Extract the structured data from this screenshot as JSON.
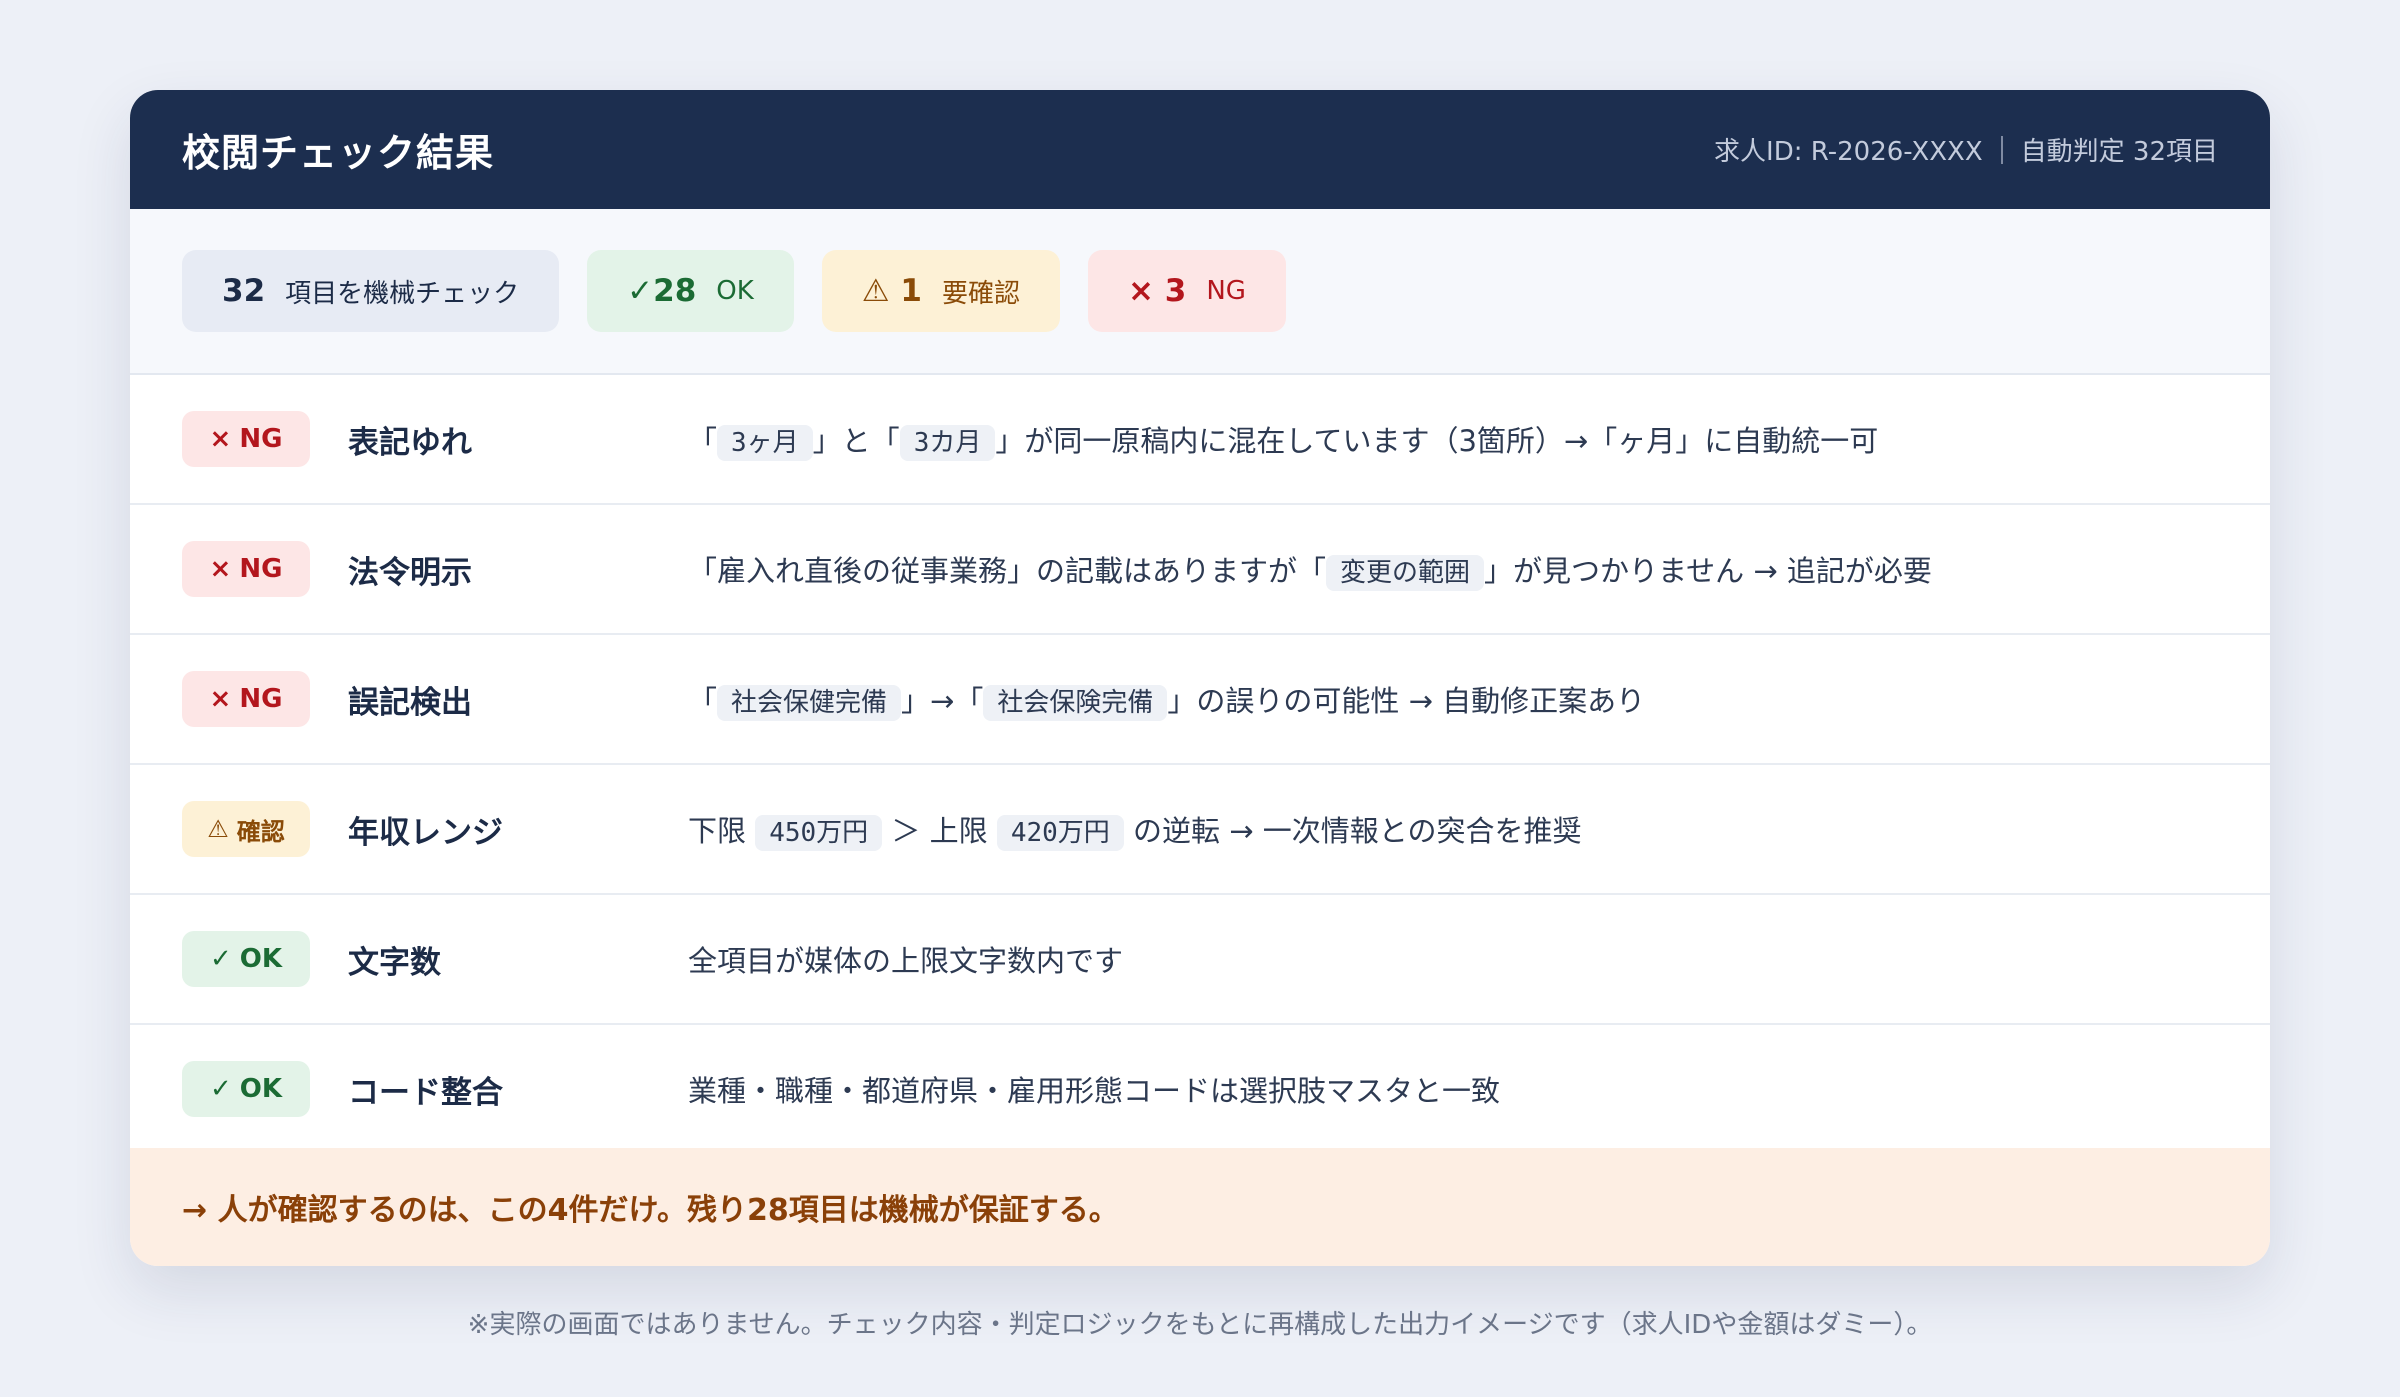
{
  "header": {
    "title": "校閲チェック結果",
    "job_id": "求人ID: R-2026-XXXX",
    "auto_judge": "自動判定 32項目"
  },
  "summary": {
    "total": {
      "num": "32",
      "label": "項目を機械チェック"
    },
    "ok": {
      "symbol": "✓",
      "num": "28",
      "label": "OK"
    },
    "warn": {
      "symbol": "⚠",
      "num": "1",
      "label": "要確認"
    },
    "ng": {
      "symbol": "×",
      "num": "3",
      "label": "NG"
    }
  },
  "rows": [
    {
      "status": "ng",
      "badge_symbol": "×",
      "badge_text": "NG",
      "label": "表記ゆれ",
      "msg": {
        "p1": "「",
        "c1": "3ヶ月",
        "p2": "」と「",
        "c2": "3カ月",
        "p3": "」が同一原稿内に混在しています（3箇所）→「ヶ月」に自動統一可"
      }
    },
    {
      "status": "ng",
      "badge_symbol": "×",
      "badge_text": "NG",
      "label": "法令明示",
      "msg": {
        "p1": "「雇入れ直後の従事業務」の記載はありますが「",
        "c1": "変更の範囲",
        "p2": "」が見つかりません → 追記が必要"
      }
    },
    {
      "status": "ng",
      "badge_symbol": "×",
      "badge_text": "NG",
      "label": "誤記検出",
      "msg": {
        "p1": "「",
        "c1": "社会保健完備",
        "p2": "」→「",
        "c2": "社会保険完備",
        "p3": "」の誤りの可能性 → 自動修正案あり"
      }
    },
    {
      "status": "warn",
      "badge_symbol": "⚠",
      "badge_text": "確認",
      "label": "年収レンジ",
      "msg": {
        "p1": "下限 ",
        "c1": "450万円",
        "p2": " ＞ 上限 ",
        "c2": "420万円",
        "p3": " の逆転 → 一次情報との突合を推奨"
      }
    },
    {
      "status": "ok",
      "badge_symbol": "✓",
      "badge_text": "OK",
      "label": "文字数",
      "msg": {
        "p1": "全項目が媒体の上限文字数内です"
      }
    },
    {
      "status": "ok",
      "badge_symbol": "✓",
      "badge_text": "OK",
      "label": "コード整合",
      "msg": {
        "p1": "業種・職種・都道府県・雇用形態コードは選択肢マスタと一致"
      }
    }
  ],
  "footer": "→ 人が確認するのは、この4件だけ。残り28項目は機械が保証する。",
  "note": "※実際の画面ではありません。チェック内容・判定ロジックをもとに再構成した出力イメージです（求人IDや金額はダミー）。"
}
